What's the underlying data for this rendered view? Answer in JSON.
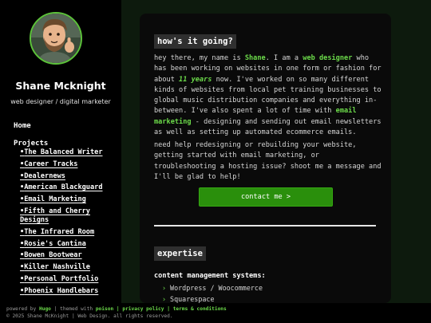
{
  "sidebar": {
    "name": "Shane Mcknight",
    "tagline": "web designer / digital marketer",
    "home_label": "Home",
    "projects_label": "Projects",
    "projects": [
      "The Balanced Writer",
      "Career Tracks",
      "Dealernews",
      "American Blackguard",
      "Email Marketing",
      "Fifth and Cherry Designs",
      "The Infrared Room",
      "Rosie's Cantina",
      "Bowen Bootwear",
      "Killer Nashville",
      "Personal Portfolio",
      "Phoenix Handlebars"
    ]
  },
  "main": {
    "intro_heading": "how's it going?",
    "intro": {
      "p1_a": "hey there, my name is ",
      "p1_name": "Shane",
      "p1_b": ". I am a ",
      "p1_role": "web designer",
      "p1_c": " who has been working on websites in one form or fashion for about ",
      "p1_years": "11 years",
      "p1_d": " now. I've worked on so many different kinds of websites from local pet training businesses to global music distribution companies and everything in-between. I've also spent a lot of time with ",
      "p1_email": "email marketing",
      "p1_e": " - designing and sending out email newsletters as well as setting up automated ecommerce emails.",
      "p2": "need help redesigning or rebuilding your website, getting started with email marketing, or troubleshooting a hosting issue? shoot me a message and I'll be glad to help!"
    },
    "contact_button": "contact me >",
    "expertise_heading": "expertise",
    "cms_label": "content management systems:",
    "cms_items": [
      "Wordpress / Woocommerce",
      "Squarespace"
    ]
  },
  "footer": {
    "powered_by": "powered by",
    "hugo": "Hugo",
    "themed_with": "| themed with",
    "poison": "poison",
    "privacy": "| privacy policy",
    "terms": "| terms & conditions",
    "copyright": "© 2025 Shane McKnight | Web Design. all rights reserved."
  },
  "colors": {
    "accent": "#6cdb4a",
    "button": "#2a8f0c",
    "page_bg": "#0d1a0d",
    "card_bg": "#0a0a0a",
    "sidebar_bg": "#000000"
  }
}
